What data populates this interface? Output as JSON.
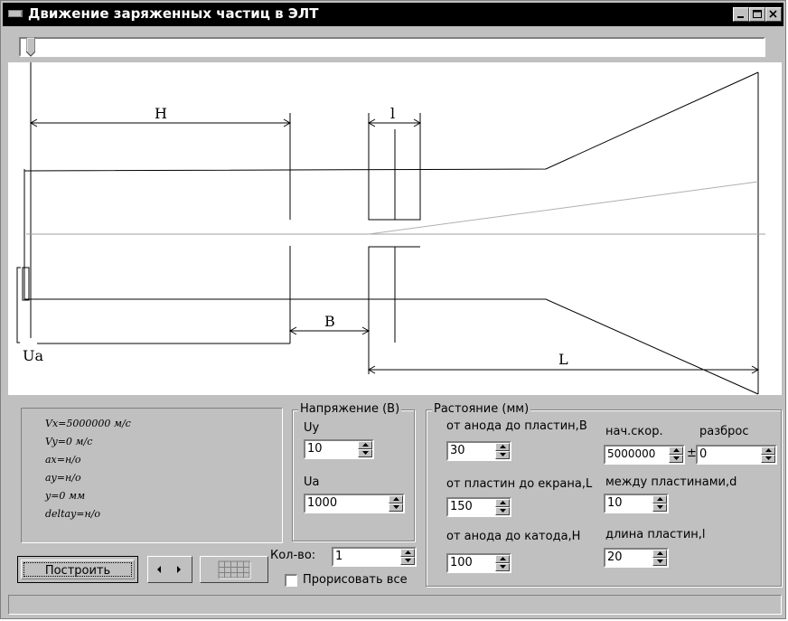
{
  "window": {
    "title": "Движение заряженных частиц в ЭЛТ",
    "minimize_icon": "minimize-icon",
    "maximize_icon": "maximize-icon",
    "close_icon": "close-icon"
  },
  "slider": {
    "value": 0
  },
  "diagram": {
    "label_H": "H",
    "label_l": "l",
    "label_B": "B",
    "label_L": "L",
    "label_Ua": "Ua"
  },
  "info": {
    "vx": "Vx=5000000 м/с",
    "vy": "Vy=0 м/с",
    "ax": "ax=н/о",
    "ay": "ay=н/о",
    "y": "y=0 мм",
    "deltay": "deltay=н/о"
  },
  "voltage": {
    "title": "Напряжение (В)",
    "uy_label": "Uy",
    "uy_value": "10",
    "ua_label": "Ua",
    "ua_value": "1000"
  },
  "distance": {
    "title": "Растояние (мм)",
    "anode_plates_label": "от анода до пластин,B",
    "anode_plates_value": "30",
    "plates_screen_label": "от пластин до екрана,L",
    "plates_screen_value": "150",
    "anode_cathode_label": "от анода до катода,H",
    "anode_cathode_value": "100",
    "speed_label": "нач.скор.",
    "speed_value": "5000000",
    "spread_label": "разброс",
    "spread_value": "0",
    "pm_sign": "±",
    "between_plates_label": "между пластинами,d",
    "between_plates_value": "10",
    "plate_length_label": "длина пластин,l",
    "plate_length_value": "20"
  },
  "controls": {
    "build_label": "Построить",
    "count_label": "Кол-во:",
    "count_value": "1",
    "draw_all_label": "Прорисовать все",
    "draw_all_checked": false
  }
}
